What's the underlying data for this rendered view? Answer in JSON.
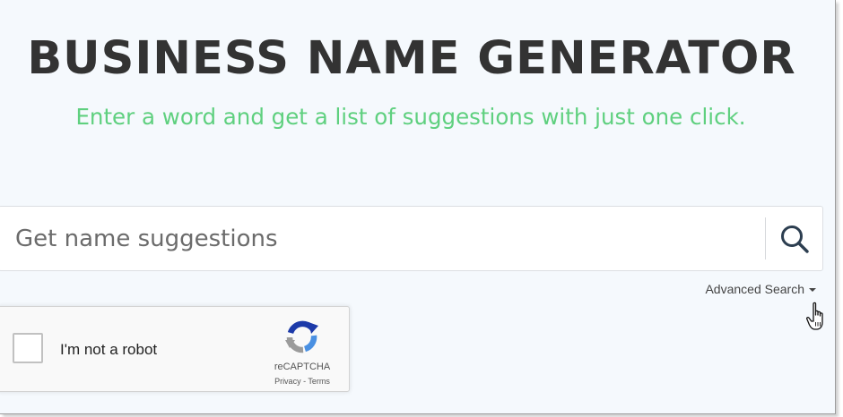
{
  "header": {
    "title": "BUSINESS NAME GENERATOR",
    "subtitle": "Enter a word and get a list of suggestions with just one click."
  },
  "search": {
    "placeholder": "Get name suggestions",
    "value": "",
    "button_icon": "search-icon",
    "advanced_label": "Advanced Search"
  },
  "recaptcha": {
    "checkbox_label": "I'm not a robot",
    "brand": "reCAPTCHA",
    "privacy": "Privacy",
    "separator": " - ",
    "terms": "Terms",
    "checked": false
  },
  "colors": {
    "background": "#f5f9fd",
    "title": "#333333",
    "subtitle": "#5fd07f",
    "search_icon": "#2c3e50"
  },
  "cursor": {
    "icon": "hand-pointer-icon"
  }
}
